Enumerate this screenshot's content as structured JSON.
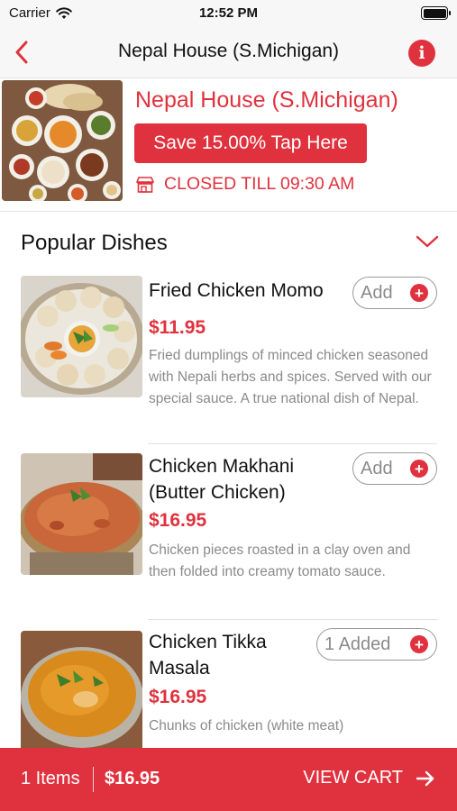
{
  "status_bar": {
    "carrier": "Carrier",
    "time": "12:52 PM"
  },
  "nav": {
    "title": "Nepal House (S.Michigan)",
    "info_icon_glyph": "i"
  },
  "restaurant": {
    "name": "Nepal House (S.Michigan)",
    "promo_label": "Save 15.00% Tap Here",
    "status": "CLOSED TILL 09:30 AM"
  },
  "section": {
    "title": "Popular Dishes"
  },
  "dishes": [
    {
      "name": "Fried Chicken Momo",
      "price": "$11.95",
      "description": "Fried dumplings of minced chicken seasoned with Nepali herbs and spices. Served with our special sauce. A true national dish of Nepal.",
      "button_label": "Add"
    },
    {
      "name": "Chicken Makhani (Butter Chicken)",
      "price": "$16.95",
      "description": "Chicken pieces roasted in a clay oven and then folded into creamy tomato sauce.",
      "button_label": "Add"
    },
    {
      "name": "Chicken Tikka Masala",
      "price": "$16.95",
      "description": "Chunks of chicken (white meat)",
      "button_label": "1 Added"
    }
  ],
  "cart": {
    "items": "1 Items",
    "total": "$16.95",
    "view_label": "VIEW CART"
  },
  "colors": {
    "accent": "#e0323e",
    "text": "#111111",
    "muted": "#8a8a8a",
    "bar": "#f7f7f7"
  },
  "icons": {
    "wifi": "wifi-icon",
    "battery": "battery-icon",
    "back": "chevron-left-icon",
    "info": "info-icon",
    "store": "store-icon",
    "collapse": "chevron-down-icon",
    "plus": "plus-circle-icon",
    "arrow": "arrow-right-icon"
  }
}
